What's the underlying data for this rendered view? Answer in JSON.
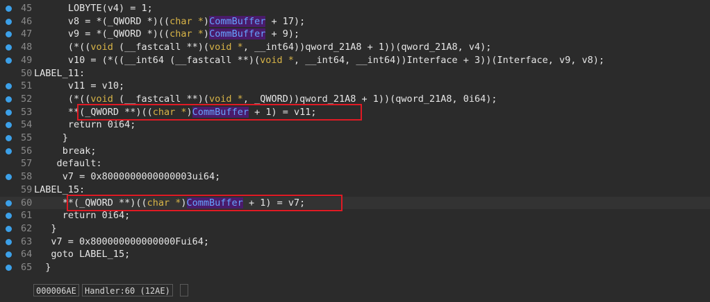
{
  "editor": {
    "lines": [
      {
        "num": "45",
        "dot": true,
        "indent": 6,
        "tokens": [
          [
            "plain",
            "LOBYTE(v4) = 1;"
          ]
        ]
      },
      {
        "num": "46",
        "dot": true,
        "indent": 6,
        "tokens": [
          [
            "plain",
            "v8 = *(_QWORD *)(("
          ],
          [
            "type",
            "char *"
          ],
          [
            "plain",
            ")"
          ],
          [
            "name",
            "CommBuffer"
          ],
          [
            "plain",
            " + 17);"
          ]
        ]
      },
      {
        "num": "47",
        "dot": true,
        "indent": 6,
        "tokens": [
          [
            "plain",
            "v9 = *(_QWORD *)(("
          ],
          [
            "type",
            "char *"
          ],
          [
            "plain",
            ")"
          ],
          [
            "name",
            "CommBuffer"
          ],
          [
            "plain",
            " + 9);"
          ]
        ]
      },
      {
        "num": "48",
        "dot": true,
        "indent": 6,
        "tokens": [
          [
            "plain",
            "(*(("
          ],
          [
            "type",
            "void"
          ],
          [
            "plain",
            " (__fastcall **)("
          ],
          [
            "type",
            "void *"
          ],
          [
            "plain",
            ", __int64))qword_21A8 + 1))(qword_21A8, v4);"
          ]
        ]
      },
      {
        "num": "49",
        "dot": true,
        "indent": 6,
        "tokens": [
          [
            "plain",
            "v10 = (*((__int64 (__fastcall **)("
          ],
          [
            "type",
            "void *"
          ],
          [
            "plain",
            ", __int64, __int64))Interface + 3))(Interface, v9, v8);"
          ]
        ]
      },
      {
        "num": "50",
        "dot": false,
        "indent": 0,
        "tokens": [
          [
            "plain",
            "LABEL_11:"
          ]
        ]
      },
      {
        "num": "51",
        "dot": true,
        "indent": 6,
        "tokens": [
          [
            "plain",
            "v11 = v10;"
          ]
        ]
      },
      {
        "num": "52",
        "dot": true,
        "indent": 6,
        "tokens": [
          [
            "plain",
            "(*(("
          ],
          [
            "type",
            "void"
          ],
          [
            "plain",
            " (__fastcall **)("
          ],
          [
            "type",
            "void *"
          ],
          [
            "plain",
            ", _QWORD))qword_21A8 + 1))(qword_21A8, 0i64);"
          ]
        ]
      },
      {
        "num": "53",
        "dot": true,
        "indent": 6,
        "tokens": [
          [
            "plain",
            "**(_QWORD **)(("
          ],
          [
            "type",
            "char *"
          ],
          [
            "plain",
            ")"
          ],
          [
            "name",
            "CommBuffer"
          ],
          [
            "plain",
            " + 1) = v11;"
          ]
        ]
      },
      {
        "num": "54",
        "dot": true,
        "indent": 6,
        "tokens": [
          [
            "plain",
            "return 0i64;"
          ]
        ]
      },
      {
        "num": "55",
        "dot": true,
        "indent": 5,
        "tokens": [
          [
            "plain",
            "}"
          ]
        ]
      },
      {
        "num": "56",
        "dot": true,
        "indent": 5,
        "tokens": [
          [
            "plain",
            "break;"
          ]
        ]
      },
      {
        "num": "57",
        "dot": false,
        "indent": 4,
        "tokens": [
          [
            "plain",
            "default:"
          ]
        ]
      },
      {
        "num": "58",
        "dot": true,
        "indent": 5,
        "tokens": [
          [
            "plain",
            "v7 = 0x8000000000000003ui64;"
          ]
        ]
      },
      {
        "num": "59",
        "dot": false,
        "indent": 0,
        "tokens": [
          [
            "plain",
            "LABEL_15:"
          ]
        ]
      },
      {
        "num": "60",
        "dot": true,
        "indent": 5,
        "current": true,
        "tokens": [
          [
            "plain",
            "**(_QWORD **)(("
          ],
          [
            "type",
            "char *"
          ],
          [
            "plain",
            ")"
          ],
          [
            "name",
            "CommBuffer"
          ],
          [
            "plain",
            " + 1) = v7;"
          ]
        ]
      },
      {
        "num": "61",
        "dot": true,
        "indent": 5,
        "tokens": [
          [
            "plain",
            "return 0i64;"
          ]
        ]
      },
      {
        "num": "62",
        "dot": true,
        "indent": 3,
        "tokens": [
          [
            "plain",
            "}"
          ]
        ]
      },
      {
        "num": "63",
        "dot": true,
        "indent": 3,
        "tokens": [
          [
            "plain",
            "v7 = 0x800000000000000Fui64;"
          ]
        ]
      },
      {
        "num": "64",
        "dot": true,
        "indent": 3,
        "tokens": [
          [
            "plain",
            "goto LABEL_15;"
          ]
        ]
      },
      {
        "num": "65",
        "dot": true,
        "indent": 2,
        "tokens": [
          [
            "plain",
            "}"
          ]
        ]
      }
    ]
  },
  "status": {
    "address": "000006AE",
    "location": "Handler:60 (12AE)",
    "extra": ""
  }
}
